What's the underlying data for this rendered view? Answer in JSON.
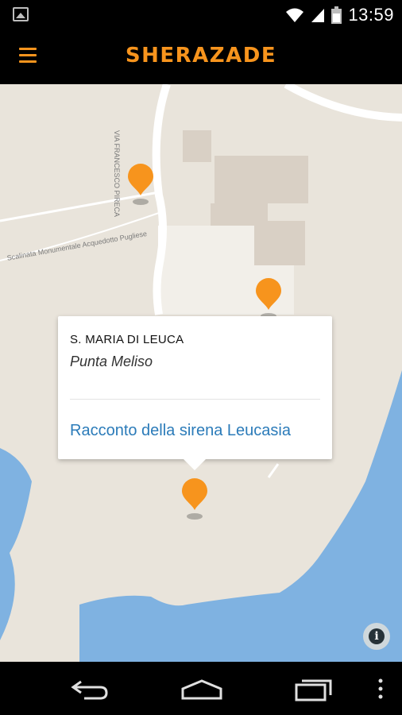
{
  "status_bar": {
    "time": "13:59",
    "icons": [
      "image-notification-icon",
      "wifi-icon",
      "signal-icon",
      "battery-icon"
    ]
  },
  "app_bar": {
    "title": "SHERAZADE",
    "menu_icon": "hamburger-menu-icon",
    "accent_color": "#f7941d"
  },
  "map": {
    "street_labels": [
      "VIA FRANCESCO PIRECA",
      "Scalinata Monumentale Acquedotto Pugliese"
    ],
    "marker_color": "#f7941d",
    "water_color": "#7fb2e1",
    "land_color": "#e9e4db"
  },
  "popup": {
    "title": "S. MARIA DI LEUCA",
    "subtitle": "Punta Meliso",
    "link": "Racconto della sirena Leucasia"
  },
  "info_button": {
    "icon": "info-icon",
    "glyph": "i"
  },
  "nav_bar": {
    "items": [
      "back-icon",
      "home-icon",
      "recent-apps-icon",
      "overflow-menu-icon"
    ]
  }
}
